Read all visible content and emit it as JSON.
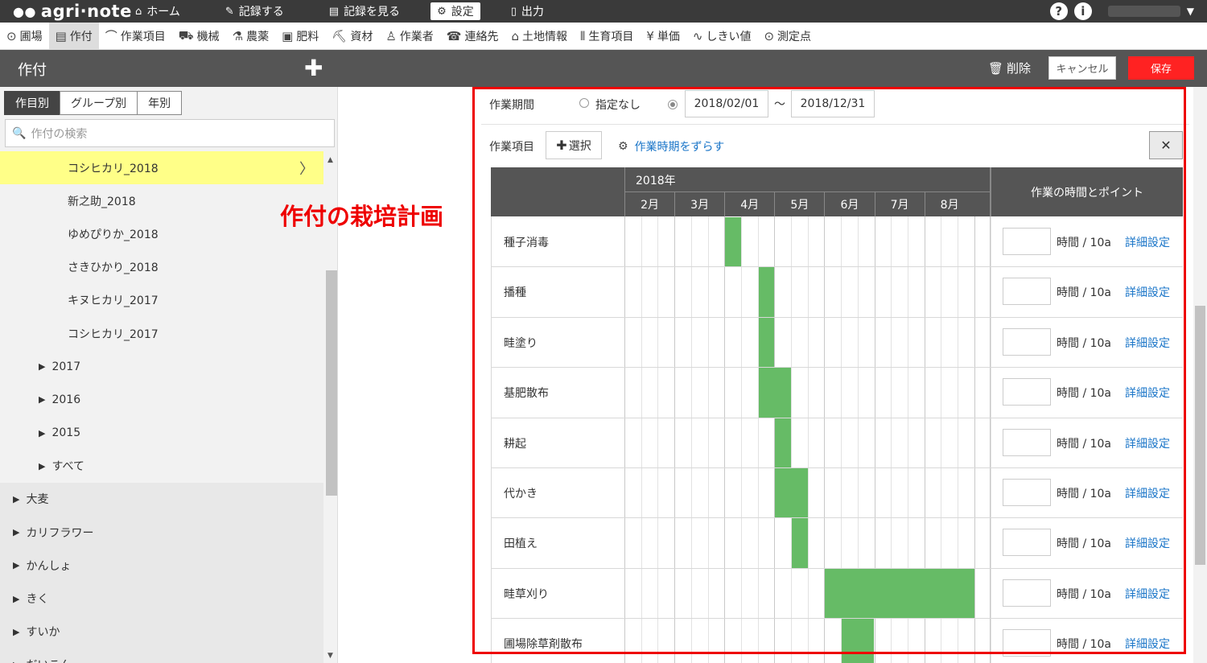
{
  "app": {
    "logo": "agri·note"
  },
  "topnav": [
    {
      "label": "ホーム",
      "icon": "home-icon",
      "glyph": "⌂"
    },
    {
      "label": "記録する",
      "icon": "pencil-icon",
      "glyph": "✎"
    },
    {
      "label": "記録を見る",
      "icon": "notebook-icon",
      "glyph": "▤"
    },
    {
      "label": "設定",
      "icon": "gear-icon",
      "glyph": "⚙",
      "active": true
    },
    {
      "label": "出力",
      "icon": "file-icon",
      "glyph": "▯"
    }
  ],
  "topright": {
    "help": "?",
    "info": "i"
  },
  "subnav": [
    {
      "label": "圃場",
      "icon": "map-pin-icon",
      "glyph": "⊙"
    },
    {
      "label": "作付",
      "icon": "document-icon",
      "glyph": "▤",
      "active": true
    },
    {
      "label": "作業項目",
      "icon": "sickle-icon",
      "glyph": "⌒"
    },
    {
      "label": "機械",
      "icon": "tractor-icon",
      "glyph": "⛟"
    },
    {
      "label": "農薬",
      "icon": "flask-icon",
      "glyph": "⚗"
    },
    {
      "label": "肥料",
      "icon": "npk-icon",
      "glyph": "▣"
    },
    {
      "label": "資材",
      "icon": "wheelbarrow-icon",
      "glyph": "⛏"
    },
    {
      "label": "作業者",
      "icon": "person-icon",
      "glyph": "♙"
    },
    {
      "label": "連絡先",
      "icon": "phone-book-icon",
      "glyph": "☎"
    },
    {
      "label": "土地情報",
      "icon": "land-icon",
      "glyph": "⌂"
    },
    {
      "label": "生育項目",
      "icon": "growth-icon",
      "glyph": "⫴"
    },
    {
      "label": "単価",
      "icon": "yen-icon",
      "glyph": "¥"
    },
    {
      "label": "しきい値",
      "icon": "line-chart-icon",
      "glyph": "∿"
    },
    {
      "label": "測定点",
      "icon": "location-icon",
      "glyph": "⊙"
    }
  ],
  "titlebar": {
    "title": "作付",
    "delete": "削除",
    "cancel": "キャンセル",
    "save": "保存"
  },
  "sidebar": {
    "tabs": [
      {
        "label": "作目別",
        "active": true
      },
      {
        "label": "グループ別"
      },
      {
        "label": "年別"
      }
    ],
    "search_placeholder": "作付の検索",
    "items": [
      {
        "label": "コシヒカリ_2018",
        "level": 2,
        "selected": true
      },
      {
        "label": "新之助_2018",
        "level": 2
      },
      {
        "label": "ゆめぴりか_2018",
        "level": 2
      },
      {
        "label": "さきひかり_2018",
        "level": 2
      },
      {
        "label": "キヌヒカリ_2017",
        "level": 2
      },
      {
        "label": "コシヒカリ_2017",
        "level": 2
      },
      {
        "label": "2017",
        "level": 1
      },
      {
        "label": "2016",
        "level": 1
      },
      {
        "label": "2015",
        "level": 1
      },
      {
        "label": "すべて",
        "level": 1
      },
      {
        "label": "大麦",
        "level": 0
      },
      {
        "label": "カリフラワー",
        "level": 0
      },
      {
        "label": "かんしょ",
        "level": 0
      },
      {
        "label": "きく",
        "level": 0
      },
      {
        "label": "すいか",
        "level": 0
      },
      {
        "label": "だいこん",
        "level": 0
      }
    ]
  },
  "annotation": "作付の栽培計画",
  "plan": {
    "period_label": "作業期間",
    "no_period_label": "指定なし",
    "start_date": "2018/02/01",
    "end_date": "2018/12/31",
    "tilde": "〜",
    "work_items_label": "作業項目",
    "select_button": "選択",
    "shift_link": "作業時期をずらす",
    "close_label": "✕",
    "year": "2018年",
    "months": [
      "2月",
      "3月",
      "4月",
      "5月",
      "6月",
      "7月",
      "8月"
    ],
    "points_header": "作業の時間とポイント",
    "unit_label": "時間 / 10a",
    "detail_label": "詳細設定",
    "rows": [
      {
        "name": "種子消毒",
        "start": 6,
        "end": 6
      },
      {
        "name": "播種",
        "start": 8,
        "end": 8
      },
      {
        "name": "畦塗り",
        "start": 8,
        "end": 8
      },
      {
        "name": "基肥散布",
        "start": 8,
        "end": 9
      },
      {
        "name": "耕起",
        "start": 9,
        "end": 9
      },
      {
        "name": "代かき",
        "start": 9,
        "end": 10
      },
      {
        "name": "田植え",
        "start": 10,
        "end": 10
      },
      {
        "name": "畦草刈り",
        "start": 12,
        "end": 20
      },
      {
        "name": "圃場除草剤散布",
        "start": 13,
        "end": 14
      }
    ]
  },
  "colors": {
    "green": "#66bb66",
    "accent_red": "#ee0000",
    "link_blue": "#1a75c8",
    "header_dark": "#555555"
  }
}
